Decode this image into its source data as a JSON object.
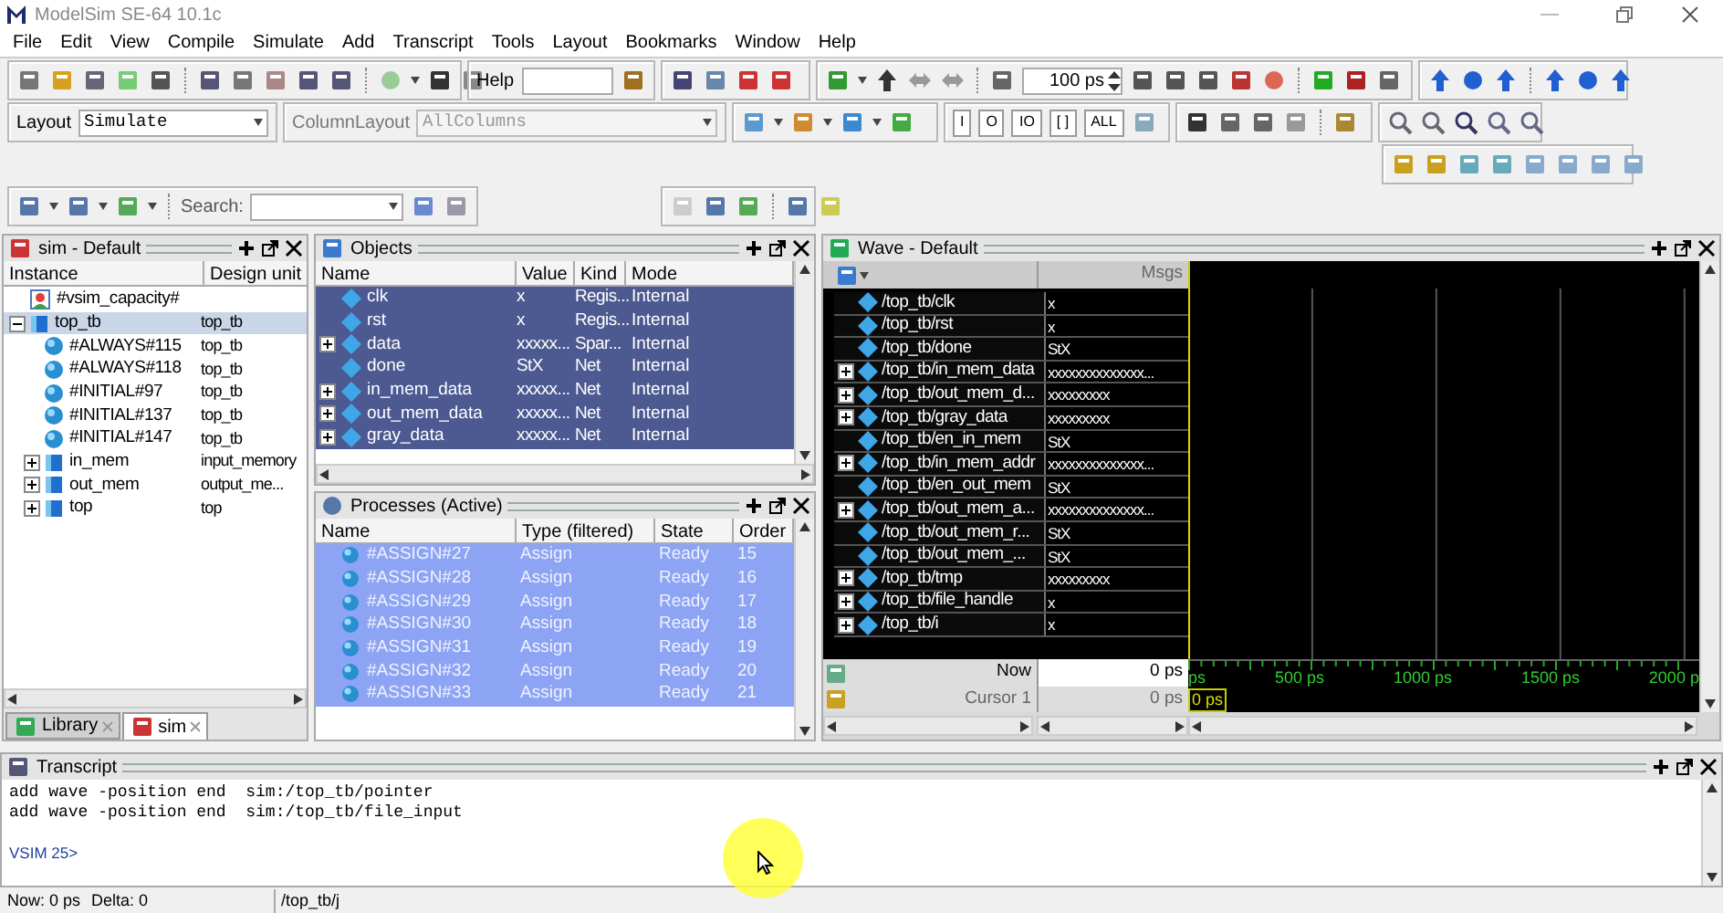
{
  "window": {
    "title": "ModelSim SE-64 10.1c"
  },
  "menu": [
    "File",
    "Edit",
    "View",
    "Compile",
    "Simulate",
    "Add",
    "Transcript",
    "Tools",
    "Layout",
    "Bookmarks",
    "Window",
    "Help"
  ],
  "toolbar": {
    "help_label": "Help",
    "run_length": "100 ps",
    "layout_label": "Layout",
    "layout_value": "Simulate",
    "column_layout_label": "ColumnLayout",
    "column_layout_value": "AllColumns",
    "search_label": "Search:",
    "wave_mode_buttons": [
      "I",
      "O",
      "IO",
      "[ ]",
      "ALL"
    ]
  },
  "sim_panel": {
    "title": "sim - Default",
    "columns": [
      "Instance",
      "Design unit"
    ],
    "rows": [
      {
        "name": "#vsim_capacity#",
        "kind": "capacity",
        "selected": false
      },
      {
        "name": "top_tb",
        "unit": "top_tb",
        "kind": "instance",
        "selected": true,
        "expanded": true,
        "children": [
          {
            "name": "#ALWAYS#115",
            "unit": "top_tb",
            "kind": "process",
            "selected": false
          },
          {
            "name": "#ALWAYS#118",
            "unit": "top_tb",
            "kind": "process",
            "selected": false
          },
          {
            "name": "#INITIAL#97",
            "unit": "top_tb",
            "kind": "process",
            "selected": false
          },
          {
            "name": "#INITIAL#137",
            "unit": "top_tb",
            "kind": "process",
            "selected": false
          },
          {
            "name": "#INITIAL#147",
            "unit": "top_tb",
            "kind": "process",
            "selected": false
          },
          {
            "name": "in_mem",
            "unit": "input_memory",
            "kind": "instance",
            "selected": false,
            "expanded": false
          },
          {
            "name": "out_mem",
            "unit": "output_me...",
            "kind": "instance",
            "selected": false,
            "expanded": false
          },
          {
            "name": "top",
            "unit": "top",
            "kind": "instance",
            "selected": false,
            "expanded": false
          }
        ]
      }
    ],
    "tabs": [
      {
        "label": "Library",
        "selected": false
      },
      {
        "label": "sim",
        "selected": true
      }
    ]
  },
  "objects_panel": {
    "title": "Objects",
    "columns": [
      "Name",
      "Value",
      "Kind",
      "Mode"
    ],
    "rows": [
      {
        "name": "clk",
        "value": "x",
        "kind": "Regis...",
        "mode": "Internal",
        "bus": false,
        "selected": true
      },
      {
        "name": "rst",
        "value": "x",
        "kind": "Regis...",
        "mode": "Internal",
        "bus": false,
        "selected": true
      },
      {
        "name": "data",
        "value": "xxxxx...",
        "kind": "Spar...",
        "mode": "Internal",
        "bus": true,
        "selected": true
      },
      {
        "name": "done",
        "value": "StX",
        "kind": "Net",
        "mode": "Internal",
        "bus": false,
        "selected": true
      },
      {
        "name": "in_mem_data",
        "value": "xxxxx...",
        "kind": "Net",
        "mode": "Internal",
        "bus": true,
        "selected": true
      },
      {
        "name": "out_mem_data",
        "value": "xxxxx...",
        "kind": "Net",
        "mode": "Internal",
        "bus": true,
        "selected": true
      },
      {
        "name": "gray_data",
        "value": "xxxxx...",
        "kind": "Net",
        "mode": "Internal",
        "bus": true,
        "selected": true
      }
    ]
  },
  "processes_panel": {
    "title": "Processes (Active)",
    "columns": [
      "Name",
      "Type (filtered)",
      "State",
      "Order"
    ],
    "rows": [
      {
        "name": "#ASSIGN#27",
        "type": "Assign",
        "state": "Ready",
        "order": "15",
        "selected": true
      },
      {
        "name": "#ASSIGN#28",
        "type": "Assign",
        "state": "Ready",
        "order": "16",
        "selected": true
      },
      {
        "name": "#ASSIGN#29",
        "type": "Assign",
        "state": "Ready",
        "order": "17",
        "selected": true
      },
      {
        "name": "#ASSIGN#30",
        "type": "Assign",
        "state": "Ready",
        "order": "18",
        "selected": true
      },
      {
        "name": "#ASSIGN#31",
        "type": "Assign",
        "state": "Ready",
        "order": "19",
        "selected": true
      },
      {
        "name": "#ASSIGN#32",
        "type": "Assign",
        "state": "Ready",
        "order": "20",
        "selected": true
      },
      {
        "name": "#ASSIGN#33",
        "type": "Assign",
        "state": "Ready",
        "order": "21",
        "selected": true
      }
    ]
  },
  "wave_panel": {
    "title": "Wave - Default",
    "msgs_header": "Msgs",
    "signals": [
      {
        "name": "/top_tb/clk",
        "value": "x",
        "bus": false
      },
      {
        "name": "/top_tb/rst",
        "value": "x",
        "bus": false
      },
      {
        "name": "/top_tb/done",
        "value": "StX",
        "bus": false
      },
      {
        "name": "/top_tb/in_mem_data",
        "value": "xxxxxxxxxxxxxx...",
        "bus": true
      },
      {
        "name": "/top_tb/out_mem_d...",
        "value": "xxxxxxxxx",
        "bus": true
      },
      {
        "name": "/top_tb/gray_data",
        "value": "xxxxxxxxx",
        "bus": true
      },
      {
        "name": "/top_tb/en_in_mem",
        "value": "StX",
        "bus": false
      },
      {
        "name": "/top_tb/in_mem_addr",
        "value": "xxxxxxxxxxxxxx...",
        "bus": true
      },
      {
        "name": "/top_tb/en_out_mem",
        "value": "StX",
        "bus": false
      },
      {
        "name": "/top_tb/out_mem_a...",
        "value": "xxxxxxxxxxxxxx...",
        "bus": true
      },
      {
        "name": "/top_tb/out_mem_r...",
        "value": "StX",
        "bus": false
      },
      {
        "name": "/top_tb/out_mem_...",
        "value": "StX",
        "bus": false
      },
      {
        "name": "/top_tb/tmp",
        "value": "xxxxxxxxx",
        "bus": true
      },
      {
        "name": "/top_tb/file_handle",
        "value": "x",
        "bus": true
      },
      {
        "name": "/top_tb/i",
        "value": "x",
        "bus": true
      }
    ],
    "now_label": "Now",
    "now_value": "0 ps",
    "cursor_label": "Cursor 1",
    "cursor_value": "0 ps",
    "cursor_time": "0 ps",
    "time_ticks": [
      "ps",
      "500 ps",
      "1000 ps",
      "1500 ps",
      "2000 p"
    ]
  },
  "transcript": {
    "title": "Transcript",
    "lines": [
      "add wave -position end  sim:/top_tb/pointer",
      "add wave -position end  sim:/top_tb/file_input"
    ],
    "prompt": "VSIM 25>"
  },
  "status_bar": {
    "now": "Now: 0 ps",
    "delta": "Delta: 0",
    "path": "/top_tb/j"
  }
}
